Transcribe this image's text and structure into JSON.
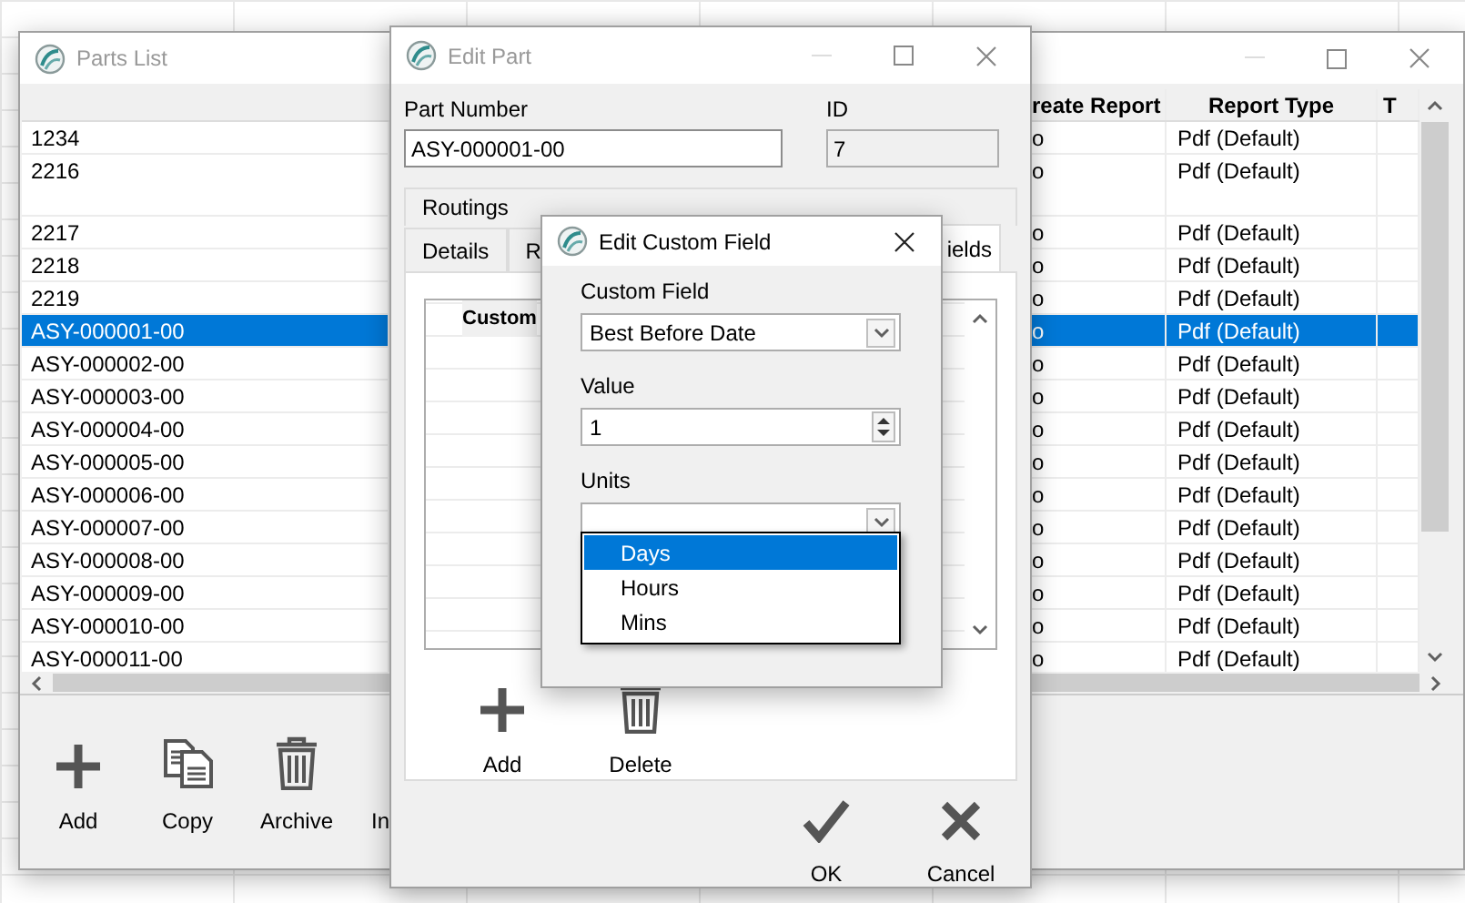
{
  "parts_list": {
    "title": "Parts List",
    "active": false,
    "columns": [
      "reate Report",
      "Report Type",
      "T"
    ],
    "rows": [
      {
        "kind": "single",
        "part_number": "1234",
        "create_report": "o",
        "report_type": "Pdf (Default)",
        "selected": false
      },
      {
        "kind": "double",
        "part_number": "2216",
        "create_report": "o",
        "report_type": "Pdf (Default)",
        "selected": false
      },
      {
        "kind": "single",
        "part_number": "2217",
        "create_report": "o",
        "report_type": "Pdf (Default)",
        "selected": false
      },
      {
        "kind": "single",
        "part_number": "2218",
        "create_report": "o",
        "report_type": "Pdf (Default)",
        "selected": false
      },
      {
        "kind": "single",
        "part_number": "2219",
        "create_report": "o",
        "report_type": "Pdf (Default)",
        "selected": false
      },
      {
        "kind": "single",
        "part_number": "ASY-000001-00",
        "create_report": "o",
        "report_type": "Pdf (Default)",
        "selected": true
      },
      {
        "kind": "single",
        "part_number": "ASY-000002-00",
        "create_report": "o",
        "report_type": "Pdf (Default)",
        "selected": false
      },
      {
        "kind": "single",
        "part_number": "ASY-000003-00",
        "create_report": "o",
        "report_type": "Pdf (Default)",
        "selected": false
      },
      {
        "kind": "single",
        "part_number": "ASY-000004-00",
        "create_report": "o",
        "report_type": "Pdf (Default)",
        "selected": false
      },
      {
        "kind": "single",
        "part_number": "ASY-000005-00",
        "create_report": "o",
        "report_type": "Pdf (Default)",
        "selected": false
      },
      {
        "kind": "single",
        "part_number": "ASY-000006-00",
        "create_report": "o",
        "report_type": "Pdf (Default)",
        "selected": false
      },
      {
        "kind": "single",
        "part_number": "ASY-000007-00",
        "create_report": "o",
        "report_type": "Pdf (Default)",
        "selected": false
      },
      {
        "kind": "single",
        "part_number": "ASY-000008-00",
        "create_report": "o",
        "report_type": "Pdf (Default)",
        "selected": false
      },
      {
        "kind": "single",
        "part_number": "ASY-000009-00",
        "create_report": "o",
        "report_type": "Pdf (Default)",
        "selected": false
      },
      {
        "kind": "single",
        "part_number": "ASY-000010-00",
        "create_report": "o",
        "report_type": "Pdf (Default)",
        "selected": false
      },
      {
        "kind": "single",
        "part_number": "ASY-000011-00",
        "create_report": "o",
        "report_type": "Pdf (Default)",
        "selected": false
      }
    ],
    "toolbar": [
      "Add",
      "Copy",
      "Archive",
      "In"
    ]
  },
  "edit_part": {
    "title": "Edit Part",
    "active": false,
    "part_number_label": "Part Number",
    "part_number": "ASY-000001-00",
    "id_label": "ID",
    "id": "7",
    "tabs_row1": [
      {
        "label": "Routings",
        "selected": false
      }
    ],
    "tabs_row2": [
      {
        "label": "Details",
        "selected": false
      },
      {
        "label": "R",
        "selected": false
      },
      {
        "label": "ields",
        "selected": true
      }
    ],
    "grid_header": "Custom",
    "actions": [
      "Add",
      "Delete"
    ],
    "buttons": [
      "OK",
      "Cancel"
    ]
  },
  "custom_field_dialog": {
    "title": "Edit Custom Field",
    "active": true,
    "custom_field_label": "Custom Field",
    "custom_field": "Best Before Date",
    "value_label": "Value",
    "value": "1",
    "units_label": "Units",
    "units_dropdown": {
      "expanded": true,
      "options": [
        {
          "label": "Days",
          "selected": true
        },
        {
          "label": "Hours",
          "selected": false
        },
        {
          "label": "Mins",
          "selected": false
        }
      ]
    }
  }
}
